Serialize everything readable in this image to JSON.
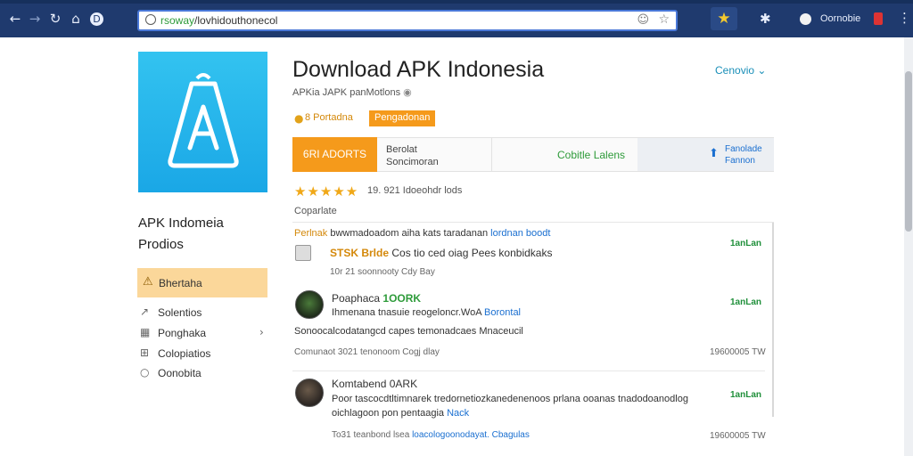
{
  "browser": {
    "url_scheme": "rsoway",
    "url_rest": "/lovhidouthonecol",
    "profile_label": "Oornobie"
  },
  "sidebar": {
    "title_line1": "APK Indomeia",
    "title_line2": "Prodios",
    "active_item": "Bhertaha",
    "items": [
      {
        "icon": "share-icon",
        "glyph": "↗",
        "label": "Solentios",
        "chevron": ""
      },
      {
        "icon": "grid-icon",
        "glyph": "▦",
        "label": "Ponghaka",
        "chevron": "›"
      },
      {
        "icon": "archive-icon",
        "glyph": "⊞",
        "label": "Colopiatios",
        "chevron": ""
      },
      {
        "icon": "circle-icon",
        "glyph": "○",
        "label": "Oonobita",
        "chevron": ""
      }
    ]
  },
  "app": {
    "title": "Download APK Indonesia",
    "subtitle": "APKia JAPK panMotlons",
    "top_link": "Cenovio",
    "rating_text": "8 Portadna",
    "rating_badge": "Pengadonan"
  },
  "actions": {
    "download_label": "6RI ADORTS",
    "info_line1": "Berolat",
    "info_line2": "Soncimoran",
    "mid_label": "Cobitle Lalens",
    "right_line1": "Fanolade",
    "right_line2": "Fannon"
  },
  "stars": {
    "glyphs": "★★★★★",
    "count_text": "19. 921 Idoeohdr lods"
  },
  "reviews_section_label": "Coparlate",
  "reviews": [
    {
      "header_prefix": "Perlnak",
      "header_mid": " bwwmadoadom aiha kats taradanan ",
      "header_link": "lordnan boodt",
      "body_highlight": "STSK Brlde",
      "body_rest": " Cos tio ced oiag  Pees konbidkaks",
      "date": "10r 21   soonnooty   Cdy Bay",
      "action": "1anLan"
    },
    {
      "author": "Poaphaca",
      "author_badge": "1OORK",
      "line1": "Ihmenana tnasuie reogeloncr.WoA ",
      "line1_link": "Borontal",
      "line2": "Sonoocalcodatangcd capes temonadcaes Mnaceucil",
      "date": "Comunaot 3021   tenonoom   Cogj dlay",
      "right_meta": "19600005 TW",
      "action": "1anLan"
    },
    {
      "author": "Komtabend",
      "author_badge": "0ARK",
      "line1": "Poor tascocdtltimnarek tredornetiozkanedenenoos prlana ooanas tnadodoanodlog",
      "line2_a": "oichlagoon pon pentaagia ",
      "line2_b": "Nack",
      "date_a": "To31   teanbond  lsea ",
      "date_link": "loacologoonodayat. Cbagulas",
      "right_meta": "19600005 TW",
      "action": "1anLan"
    }
  ]
}
